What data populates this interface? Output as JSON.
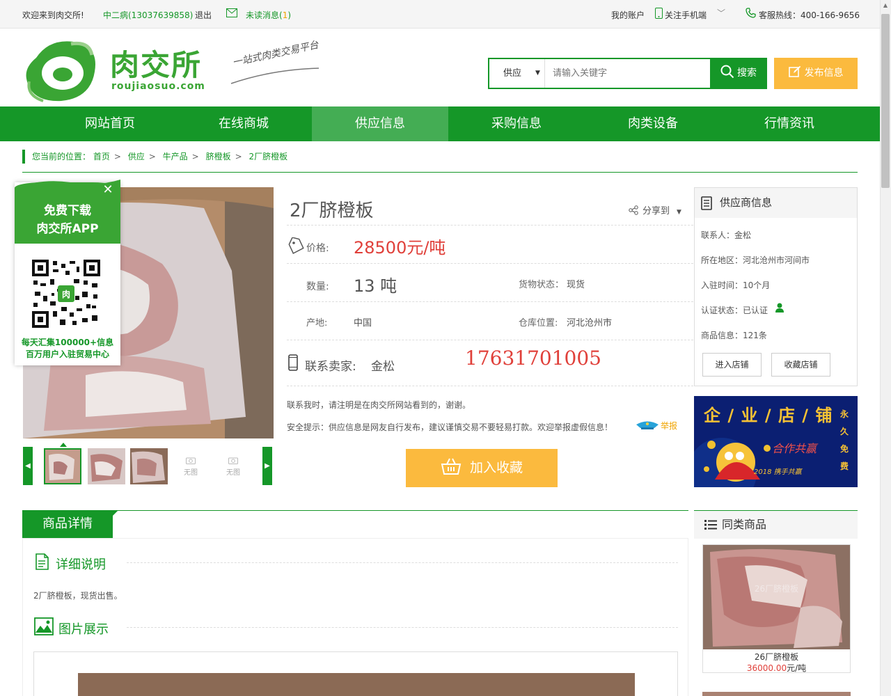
{
  "topbar": {
    "welcome": "欢迎来到肉交所!",
    "user": "中二病(13037639858)",
    "logout": "退出",
    "unread_label": "未读消息(",
    "unread_count": "1",
    "unread_close": ")",
    "my_account": "我的账户",
    "follow_mobile": "关注手机端",
    "hotline": "客服热线：400-166-9656"
  },
  "header": {
    "logo_text": "肉交所",
    "logo_sub": "roujiaosuo.com",
    "slogan": "一站式肉类交易平台",
    "search_type": "供应",
    "search_placeholder": "请输入关键字",
    "search_button": "搜索",
    "publish_button": "发布信息"
  },
  "nav": [
    "网站首页",
    "在线商城",
    "供应信息",
    "采购信息",
    "肉类设备",
    "行情资讯"
  ],
  "nav_active_index": 2,
  "breadcrumb": {
    "label": "您当前的位置：",
    "items": [
      "首页",
      "供应",
      "牛产品",
      "脐橙板",
      "2厂脐橙板"
    ]
  },
  "app_popup": {
    "title_line1": "免费下载",
    "title_line2": "肉交所APP",
    "qr_badge": "肉",
    "caption_line1": "每天汇集100000+信息",
    "caption_line2": "百万用户入驻贸易中心"
  },
  "gallery": {
    "empty_label_1": "无图",
    "empty_label_2": "无图"
  },
  "product": {
    "title": "2厂脐橙板",
    "share": "分享到",
    "price_label": "价格:",
    "price": "28500元/吨",
    "qty_label": "数量:",
    "qty": "13 吨",
    "status_label": "货物状态：",
    "status": "现货",
    "origin_label": "产地:",
    "origin": "中国",
    "warehouse_label": "仓库位置:",
    "warehouse": "河北沧州市",
    "contact_label": "联系卖家:",
    "contact_name": "金松",
    "phone": "17631701005",
    "note1": "联系我时，请注明是在肉交所网站看到的，谢谢。",
    "note2": "安全提示：供应信息是网友自行发布，建议谨慎交易不要轻易打款。欢迎举报虚假信息！",
    "report": "举报",
    "favorite_button": "加入收藏"
  },
  "supplier": {
    "title": "供应商信息",
    "contact": "联系人：金松",
    "region": "所在地区：河北沧州市河间市",
    "joined": "入驻时间：10个月",
    "cert": "认证状态：已认证",
    "goods": "商品信息：121条",
    "enter_shop": "进入店铺",
    "fav_shop": "收藏店铺"
  },
  "banner": {
    "headline": "企 / 业 / 店 / 铺",
    "side": "永久免费",
    "greeting": "合作共赢",
    "year": "2018 携手共赢"
  },
  "detail": {
    "tab": "商品详情",
    "desc_title": "详细说明",
    "desc_text": "2厂脐橙板，现货出售。",
    "pics_title": "图片展示"
  },
  "similar": {
    "title": "同类商品",
    "item_watermark": "26厂脐橙板",
    "item_name": "26厂脐橙板",
    "item_price": "36000.00",
    "item_unit": "元/吨"
  },
  "colors": {
    "brand_green": "#159728",
    "nav_active": "#44ad54",
    "accent_orange": "#fbba3e",
    "price_red": "#e0403a"
  }
}
